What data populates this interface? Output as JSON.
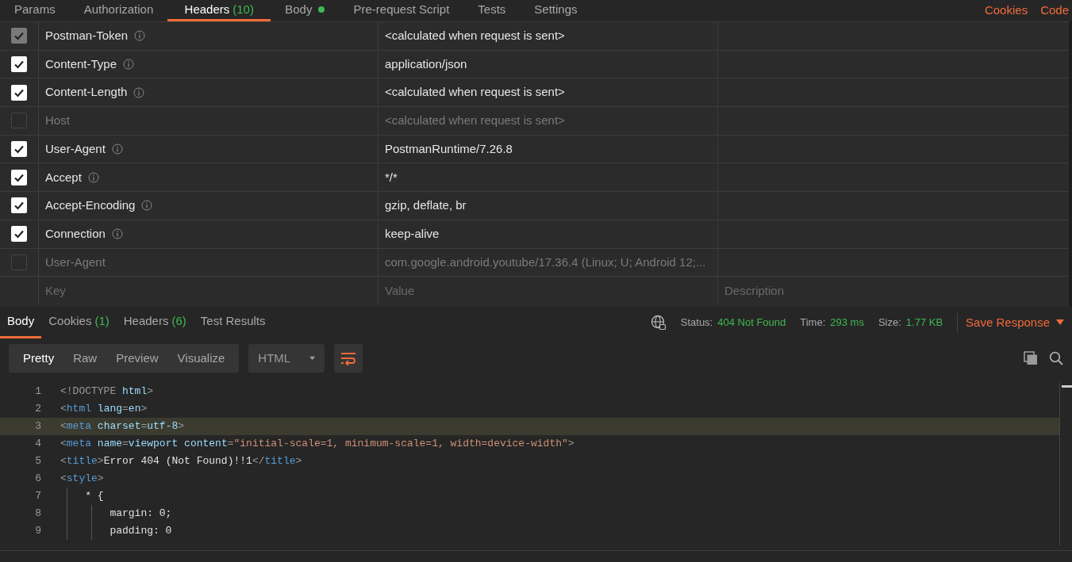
{
  "request_tabs": [
    {
      "label": "Params",
      "selected": false
    },
    {
      "label": "Authorization",
      "selected": false
    },
    {
      "label": "Headers",
      "count": "(10)",
      "selected": true
    },
    {
      "label": "Body",
      "dot": true,
      "selected": false
    },
    {
      "label": "Pre-request Script",
      "selected": false
    },
    {
      "label": "Tests",
      "selected": false
    },
    {
      "label": "Settings",
      "selected": false
    }
  ],
  "top_links": [
    "Cookies",
    "Code"
  ],
  "headers": [
    {
      "key": "Postman-Token",
      "value": "<calculated when request is sent>",
      "checked": true,
      "disabled": true
    },
    {
      "key": "Content-Type",
      "value": "application/json",
      "checked": true
    },
    {
      "key": "Content-Length",
      "value": "<calculated when request is sent>",
      "checked": true
    },
    {
      "key": "Host",
      "value": "<calculated when request is sent>",
      "checked": false
    },
    {
      "key": "User-Agent",
      "value": "PostmanRuntime/7.26.8",
      "checked": true
    },
    {
      "key": "Accept",
      "value": "*/*",
      "checked": true
    },
    {
      "key": "Accept-Encoding",
      "value": "gzip, deflate, br",
      "checked": true
    },
    {
      "key": "Connection",
      "value": "keep-alive",
      "checked": true
    },
    {
      "key": "User-Agent",
      "value": "com.google.android.youtube/17.36.4 (Linux; U; Android 12;...",
      "checked": false
    }
  ],
  "new_row": {
    "key_placeholder": "Key",
    "value_placeholder": "Value",
    "description_placeholder": "Description"
  },
  "response_tabs": [
    {
      "label": "Body",
      "selected": true
    },
    {
      "label": "Cookies",
      "count": "(1)",
      "selected": false
    },
    {
      "label": "Headers",
      "count": "(6)",
      "selected": false
    },
    {
      "label": "Test Results",
      "selected": false
    }
  ],
  "stats": [
    {
      "label": "Status:",
      "value": "404 Not Found"
    },
    {
      "label": "Time:",
      "value": "293 ms"
    },
    {
      "label": "Size:",
      "value": "1.77 KB"
    }
  ],
  "save_response": "Save Response",
  "view_modes": [
    {
      "label": "Pretty",
      "selected": true
    },
    {
      "label": "Raw",
      "selected": false
    },
    {
      "label": "Preview",
      "selected": false
    },
    {
      "label": "Visualize",
      "selected": false
    }
  ],
  "format": "HTML",
  "code": [
    {
      "number": "1",
      "highlighted": false,
      "tokens": [
        {
          "kind": "punct",
          "text": "<!DOCTYPE"
        },
        {
          "kind": "attr",
          "text": " html"
        },
        {
          "kind": "punct",
          "text": ">"
        }
      ]
    },
    {
      "number": "2",
      "highlighted": false,
      "tokens": [
        {
          "kind": "punct",
          "text": "<"
        },
        {
          "kind": "tag",
          "text": "html"
        },
        {
          "kind": "attr",
          "text": " lang"
        },
        {
          "kind": "punct",
          "text": "="
        },
        {
          "kind": "attr",
          "text": "en"
        },
        {
          "kind": "punct",
          "text": ">"
        }
      ]
    },
    {
      "number": "3",
      "highlighted": true,
      "tokens": [
        {
          "kind": "punct",
          "text": "<"
        },
        {
          "kind": "tag",
          "text": "meta"
        },
        {
          "kind": "attr",
          "text": " charset"
        },
        {
          "kind": "punct",
          "text": "="
        },
        {
          "kind": "attr",
          "text": "utf-8"
        },
        {
          "kind": "punct",
          "text": ">"
        }
      ]
    },
    {
      "number": "4",
      "highlighted": false,
      "tokens": [
        {
          "kind": "punct",
          "text": "<"
        },
        {
          "kind": "tag",
          "text": "meta"
        },
        {
          "kind": "attr",
          "text": " name"
        },
        {
          "kind": "punct",
          "text": "="
        },
        {
          "kind": "attr",
          "text": "viewport"
        },
        {
          "kind": "attr",
          "text": " content"
        },
        {
          "kind": "punct",
          "text": "="
        },
        {
          "kind": "string",
          "text": "\"initial-scale=1, minimum-scale=1, width=device-width\""
        },
        {
          "kind": "punct",
          "text": ">"
        }
      ]
    },
    {
      "number": "5",
      "highlighted": false,
      "tokens": [
        {
          "kind": "punct",
          "text": "<"
        },
        {
          "kind": "tag",
          "text": "title"
        },
        {
          "kind": "punct",
          "text": ">"
        },
        {
          "kind": "text",
          "text": "Error 404 (Not Found)!!1"
        },
        {
          "kind": "punct",
          "text": "</"
        },
        {
          "kind": "tag",
          "text": "title"
        },
        {
          "kind": "punct",
          "text": ">"
        }
      ]
    },
    {
      "number": "6",
      "highlighted": false,
      "tokens": [
        {
          "kind": "punct",
          "text": "<"
        },
        {
          "kind": "tag",
          "text": "style"
        },
        {
          "kind": "punct",
          "text": ">"
        }
      ]
    },
    {
      "number": "7",
      "highlighted": false,
      "tokens": [
        {
          "kind": "text",
          "text": "    * {"
        }
      ]
    },
    {
      "number": "8",
      "highlighted": false,
      "tokens": [
        {
          "kind": "text",
          "text": "        margin: 0;"
        }
      ]
    },
    {
      "number": "9",
      "highlighted": false,
      "tokens": [
        {
          "kind": "text",
          "text": "        padding: 0"
        }
      ]
    }
  ]
}
